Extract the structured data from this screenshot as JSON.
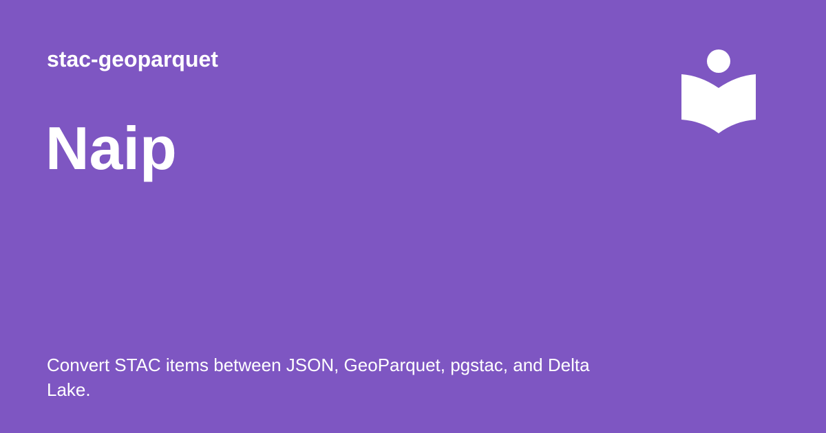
{
  "site": {
    "name": "stac-geoparquet"
  },
  "page": {
    "title": "Naip",
    "description": "Convert STAC items between JSON, GeoParquet, pgstac, and Delta Lake."
  },
  "logo": {
    "icon": "book-reader-icon"
  },
  "colors": {
    "background": "#7e56c2",
    "text": "#ffffff"
  }
}
